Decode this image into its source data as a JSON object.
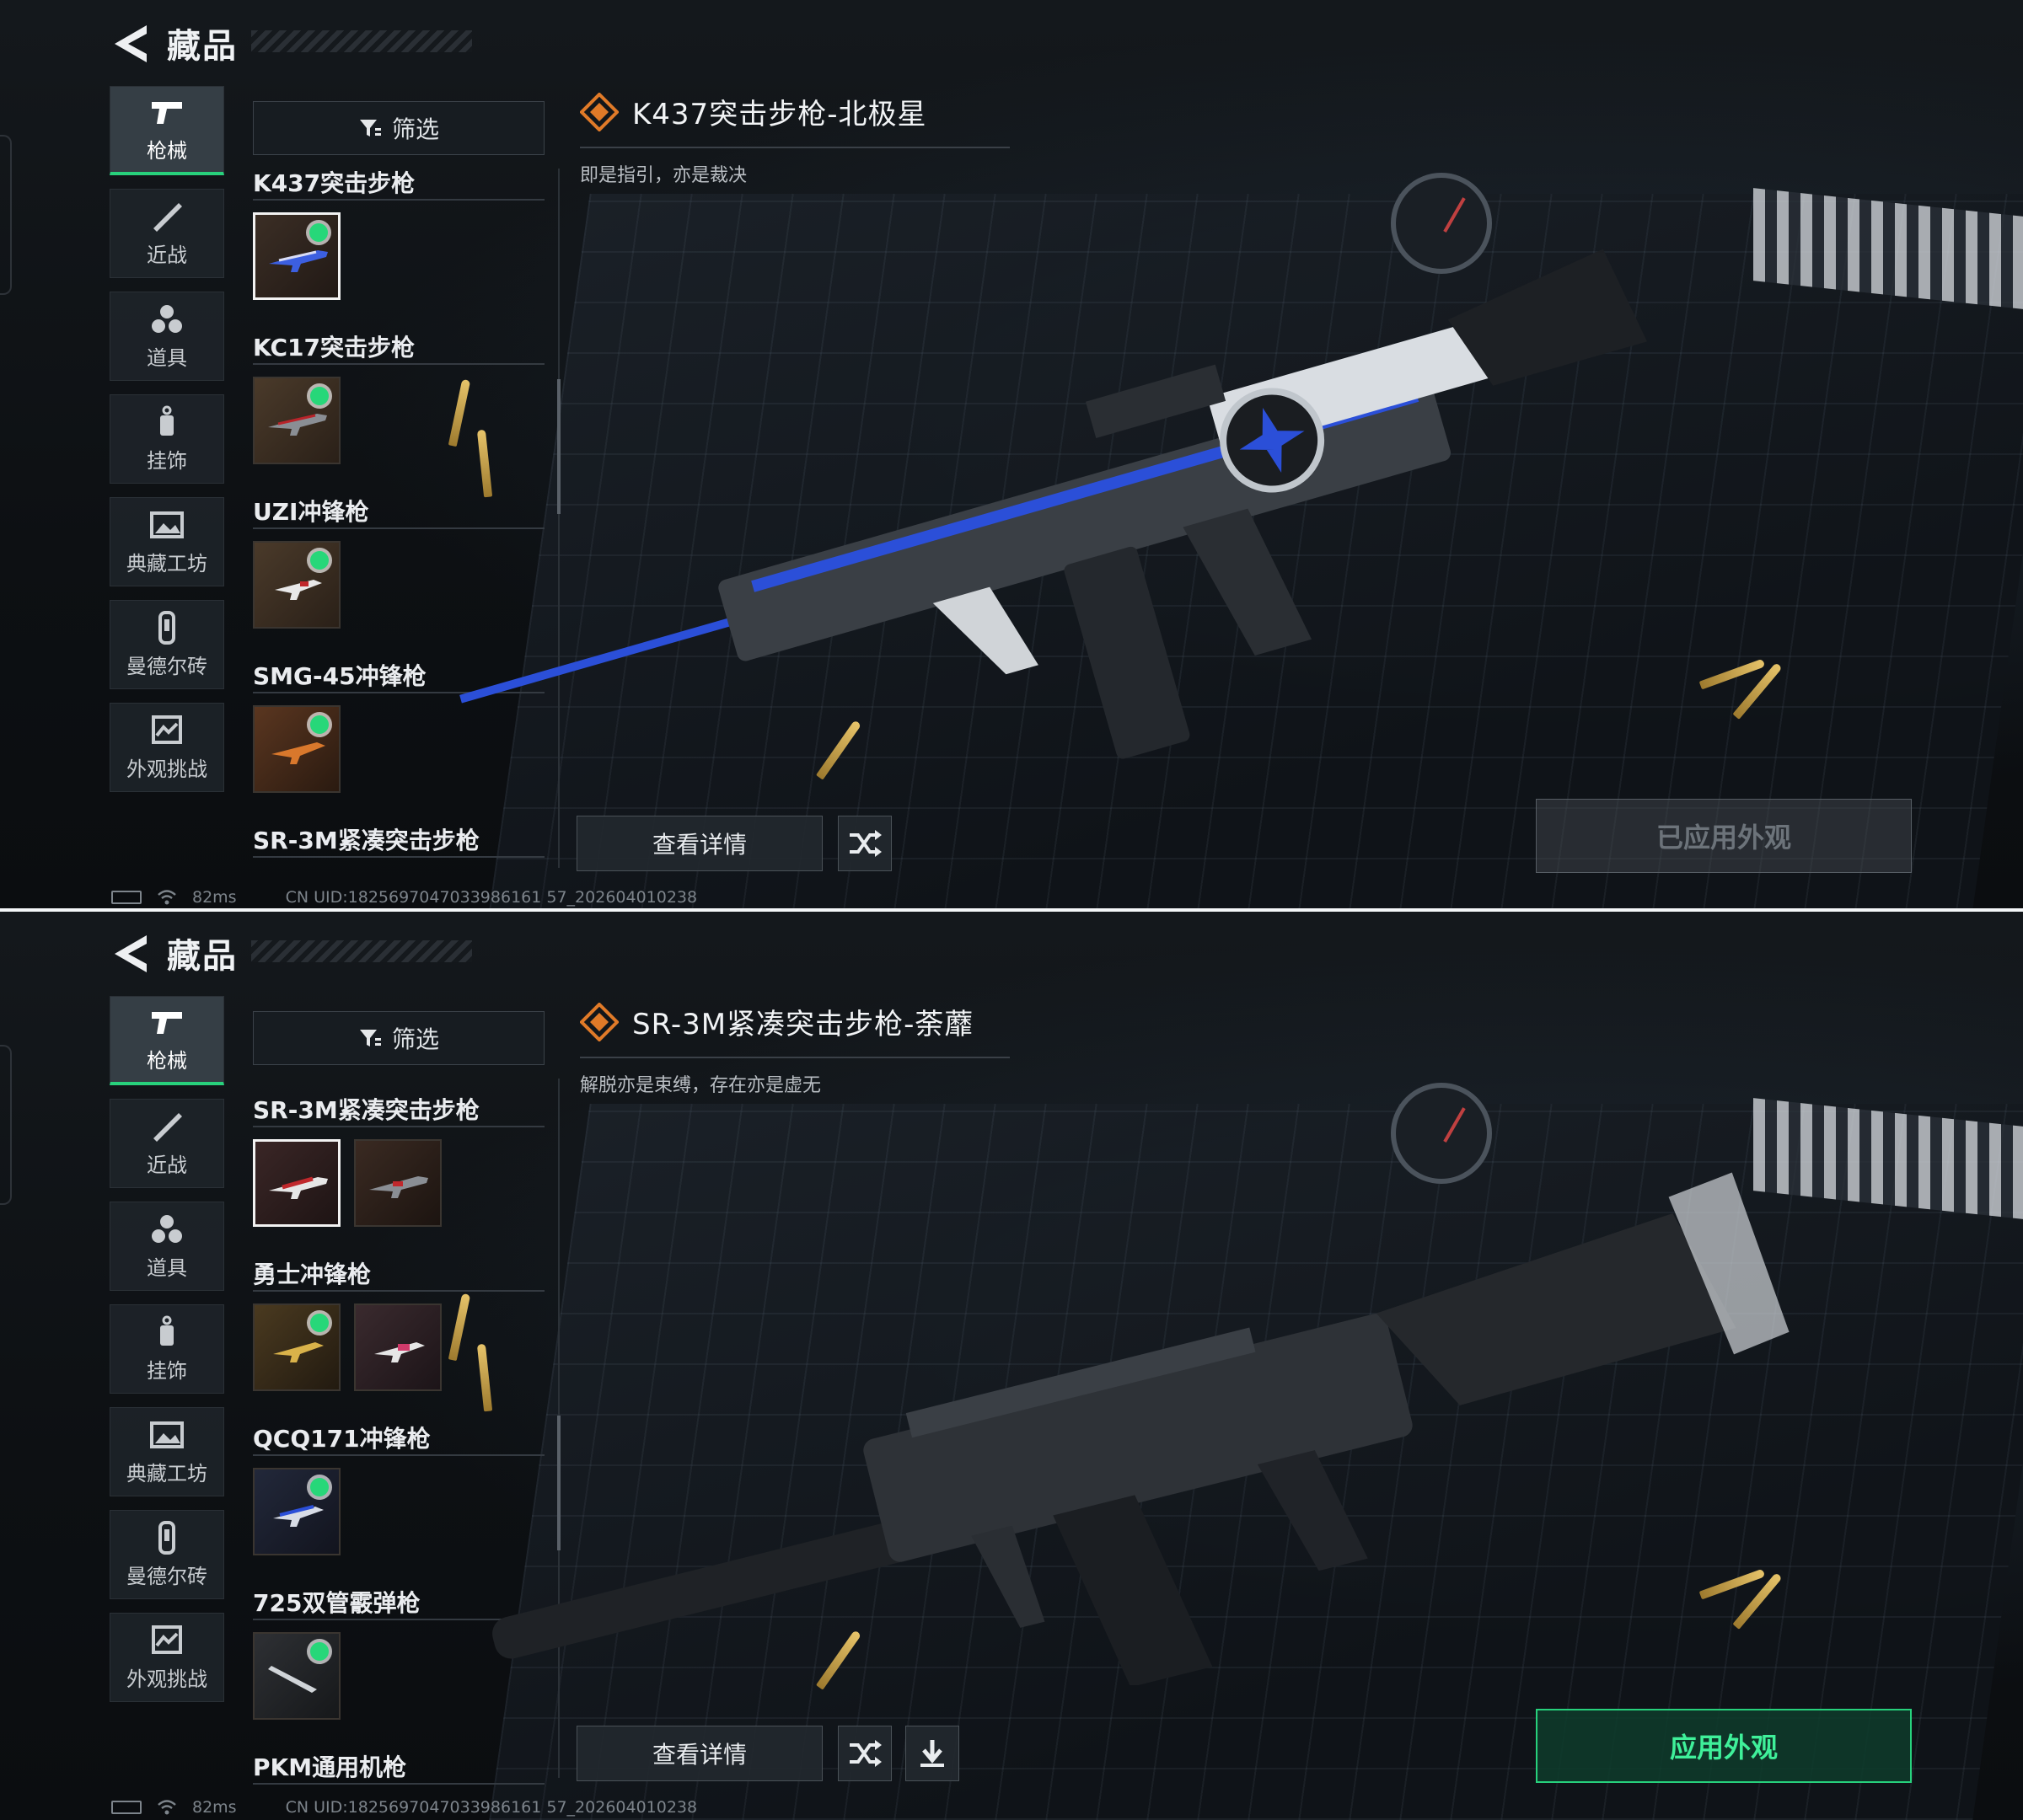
{
  "common": {
    "header_title": "藏品",
    "filter_label": "筛选",
    "detail_button": "查看详情",
    "ping": "82ms",
    "uid": "CN UID:1825697047033986161 57_202604010238",
    "categories": [
      {
        "label": "枪械",
        "icon": "pistol-icon"
      },
      {
        "label": "近战",
        "icon": "knife-icon"
      },
      {
        "label": "道具",
        "icon": "grenade-cluster-icon"
      },
      {
        "label": "挂饰",
        "icon": "charm-icon"
      },
      {
        "label": "典藏工坊",
        "icon": "gallery-icon"
      },
      {
        "label": "曼德尔砖",
        "icon": "brick-icon"
      },
      {
        "label": "外观挑战",
        "icon": "challenge-icon"
      }
    ],
    "active_category_index": 0,
    "colors": {
      "accent_green": "#27d17c",
      "title_icon_orange": "#e07a28",
      "gun_blue": "#2b4fd8",
      "gun_red": "#c0282c"
    }
  },
  "top": {
    "weapon_title": "K437突击步枪-北极星",
    "weapon_desc": "即是指引，亦是裁决",
    "apply_button": "已应用外观",
    "apply_enabled": false,
    "list": [
      {
        "name": "K437突击步枪",
        "skins": [
          {
            "selected": true,
            "owned": true,
            "tint": "blue"
          }
        ]
      },
      {
        "name": "KC17突击步枪",
        "skins": [
          {
            "selected": false,
            "owned": true,
            "tint": "red"
          }
        ]
      },
      {
        "name": "UZI冲锋枪",
        "skins": [
          {
            "selected": false,
            "owned": true,
            "tint": "red"
          }
        ]
      },
      {
        "name": "SMG-45冲锋枪",
        "skins": [
          {
            "selected": false,
            "owned": true,
            "tint": "orange"
          }
        ]
      },
      {
        "name": "SR-3M紧凑突击步枪",
        "skins": []
      }
    ]
  },
  "bottom": {
    "weapon_title": "SR-3M紧凑突击步枪-荼蘼",
    "weapon_desc": "解脱亦是束缚，存在亦是虚无",
    "apply_button": "应用外观",
    "apply_enabled": true,
    "list": [
      {
        "name": "SR-3M紧凑突击步枪",
        "skins": [
          {
            "selected": true,
            "owned": false,
            "tint": "red"
          },
          {
            "selected": false,
            "owned": false,
            "tint": "dark"
          }
        ]
      },
      {
        "name": "勇士冲锋枪",
        "skins": [
          {
            "selected": false,
            "owned": true,
            "tint": "gold"
          },
          {
            "selected": false,
            "owned": false,
            "tint": "pink"
          }
        ]
      },
      {
        "name": "QCQ171冲锋枪",
        "skins": [
          {
            "selected": false,
            "owned": true,
            "tint": "blue"
          }
        ]
      },
      {
        "name": "725双管霰弹枪",
        "skins": [
          {
            "selected": false,
            "owned": true,
            "tint": "silver"
          }
        ]
      },
      {
        "name": "PKM通用机枪",
        "skins": []
      }
    ]
  }
}
